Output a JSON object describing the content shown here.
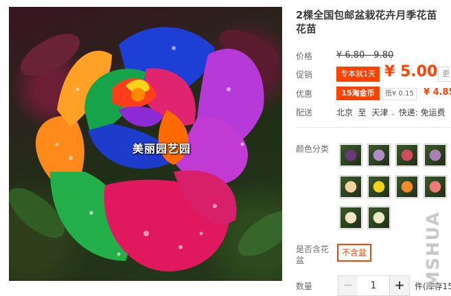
{
  "product": {
    "title_line1": "2棵全国包邮盆栽花卉月季花苗",
    "title_line2": "花苗",
    "photo_watermark": "美丽园艺园",
    "photo_alt": "rainbow rose"
  },
  "price": {
    "label": "价格",
    "original": "¥ 6.80 - 9.80"
  },
  "promo": {
    "label": "促销",
    "tag": "专本就1天",
    "price": "¥ 5.00",
    "more": "更"
  },
  "coupon": {
    "label": "优惠",
    "tag": "15淘金币",
    "deduct": "抵¥ 0.15",
    "price": "¥ 4.85"
  },
  "delivery": {
    "label": "配送",
    "from": "北京",
    "to_word": "至",
    "dest": "天津",
    "text": "快递: 免运费"
  },
  "color": {
    "label": "颜色分类",
    "swatches": [
      {
        "name": "purple-rose",
        "color": "#6a3a78"
      },
      {
        "name": "lavender-rose",
        "color": "#b08bc4"
      },
      {
        "name": "pink-red-rose",
        "color": "#d14a5d"
      },
      {
        "name": "mauve-rose",
        "color": "#a97fb2"
      },
      {
        "name": "peach-rose",
        "color": "#f2d2a5"
      },
      {
        "name": "yellow-rose",
        "color": "#f2d21b"
      },
      {
        "name": "orange-rose",
        "color": "#f08a2a"
      },
      {
        "name": "coral-rose",
        "color": "#ee7b7c"
      },
      {
        "name": "cream-rose",
        "color": "#f3e4c2"
      },
      {
        "name": "white-rose",
        "color": "#ece9c8"
      }
    ]
  },
  "pot": {
    "label_line1": "是否含花",
    "label_line2": "盆",
    "option": "不含盆"
  },
  "quantity": {
    "label": "数量",
    "minus": "−",
    "value": "1",
    "plus": "+",
    "stock": "件(库存15"
  },
  "side_watermark": "MSHUA"
}
